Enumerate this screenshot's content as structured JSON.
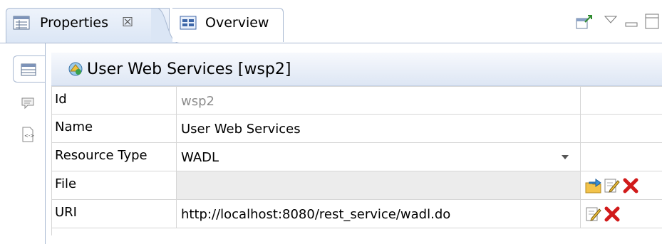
{
  "tabs": [
    {
      "label": "Properties",
      "close": "☒",
      "active": true
    },
    {
      "label": "Overview",
      "active": false
    }
  ],
  "header": {
    "title": "User Web Services [wsp2]"
  },
  "rows": [
    {
      "label": "Id",
      "value": "wsp2",
      "value_style": "muted",
      "actions": []
    },
    {
      "label": "Name",
      "value": "User Web Services",
      "actions": []
    },
    {
      "label": "Resource Type",
      "value": "WADL",
      "dropdown": true,
      "actions": []
    },
    {
      "label": "File",
      "value": "",
      "disabled": true,
      "actions": [
        "open-folder-icon",
        "edit-icon",
        "delete-icon"
      ]
    },
    {
      "label": "URI",
      "value": "http://localhost:8080/rest_service/wadl.do",
      "actions": [
        "edit-icon",
        "delete-icon"
      ]
    }
  ],
  "colors": {
    "accent": "#a9b9d2",
    "delete": "#d11a1a",
    "header_gradient_end": "#dde6f4"
  }
}
